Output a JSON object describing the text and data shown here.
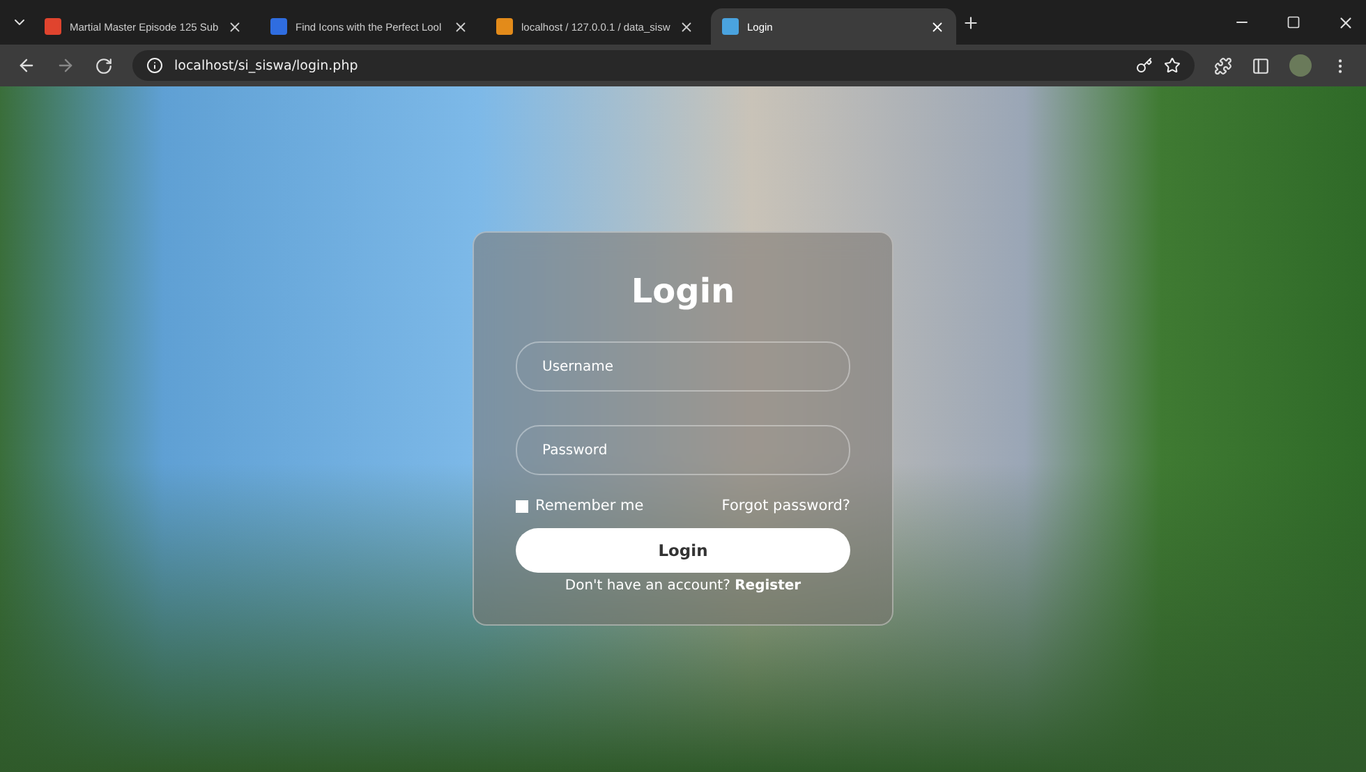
{
  "browser": {
    "tabs": [
      {
        "title": "Martial Master Episode 125 Sub",
        "selected": false
      },
      {
        "title": "Find Icons with the Perfect Lool",
        "selected": false
      },
      {
        "title": "localhost / 127.0.0.1 / data_sisw",
        "selected": false
      },
      {
        "title": "Login",
        "selected": true
      }
    ],
    "url": "localhost/si_siswa/login.php"
  },
  "login": {
    "title": "Login",
    "username": {
      "placeholder": "Username"
    },
    "password": {
      "placeholder": "Password"
    },
    "remember": {
      "label": "Remember me",
      "checked": false
    },
    "forgot": "Forgot password?",
    "button": "Login",
    "footer": {
      "text": "Don't have an account?",
      "link": "Register"
    }
  }
}
